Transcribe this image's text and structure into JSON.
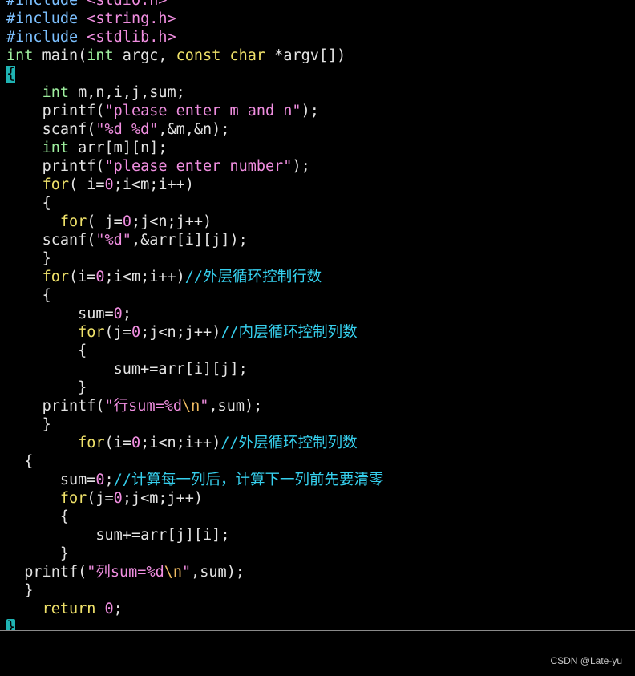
{
  "editor": {
    "lines": [
      {
        "indent": "",
        "tokens": [
          {
            "t": "#include ",
            "c": "pre"
          },
          {
            "t": "<stdio.h>",
            "c": "hdr"
          }
        ]
      },
      {
        "indent": "",
        "tokens": [
          {
            "t": "#include ",
            "c": "pre"
          },
          {
            "t": "<string.h>",
            "c": "hdr"
          }
        ]
      },
      {
        "indent": "",
        "tokens": [
          {
            "t": "#include ",
            "c": "pre"
          },
          {
            "t": "<stdlib.h>",
            "c": "hdr"
          }
        ]
      },
      {
        "indent": "",
        "tokens": [
          {
            "t": "int",
            "c": "type"
          },
          {
            "t": " main(",
            "c": "id"
          },
          {
            "t": "int",
            "c": "type"
          },
          {
            "t": " argc, ",
            "c": "id"
          },
          {
            "t": "const",
            "c": "kw"
          },
          {
            "t": " ",
            "c": "id"
          },
          {
            "t": "char",
            "c": "kw"
          },
          {
            "t": " *argv[])",
            "c": "id"
          }
        ]
      },
      {
        "indent": "",
        "tokens": [
          {
            "t": "{",
            "c": "brace-hl"
          }
        ]
      },
      {
        "indent": "    ",
        "tokens": [
          {
            "t": "int",
            "c": "type"
          },
          {
            "t": " m,n,i,j,sum;",
            "c": "id"
          }
        ]
      },
      {
        "indent": "    ",
        "tokens": [
          {
            "t": "printf(",
            "c": "id"
          },
          {
            "t": "\"please enter m and n\"",
            "c": "str"
          },
          {
            "t": ");",
            "c": "id"
          }
        ]
      },
      {
        "indent": "    ",
        "tokens": [
          {
            "t": "scanf(",
            "c": "id"
          },
          {
            "t": "\"%d %d\"",
            "c": "str"
          },
          {
            "t": ",&m,&n);",
            "c": "id"
          }
        ]
      },
      {
        "indent": "    ",
        "tokens": [
          {
            "t": "int",
            "c": "type"
          },
          {
            "t": " arr[m][n];",
            "c": "id"
          }
        ]
      },
      {
        "indent": "    ",
        "tokens": [
          {
            "t": "printf(",
            "c": "id"
          },
          {
            "t": "\"please enter number\"",
            "c": "str"
          },
          {
            "t": ");",
            "c": "id"
          }
        ]
      },
      {
        "indent": "    ",
        "tokens": [
          {
            "t": "for",
            "c": "kw"
          },
          {
            "t": "( i=",
            "c": "id"
          },
          {
            "t": "0",
            "c": "num"
          },
          {
            "t": ";i<m;i++)",
            "c": "id"
          }
        ]
      },
      {
        "indent": "    ",
        "tokens": [
          {
            "t": "{",
            "c": "id"
          }
        ]
      },
      {
        "indent": "      ",
        "tokens": [
          {
            "t": "for",
            "c": "kw"
          },
          {
            "t": "( j=",
            "c": "id"
          },
          {
            "t": "0",
            "c": "num"
          },
          {
            "t": ";j<n;j++)",
            "c": "id"
          }
        ]
      },
      {
        "indent": "    ",
        "tokens": [
          {
            "t": "scanf(",
            "c": "id"
          },
          {
            "t": "\"%d\"",
            "c": "str"
          },
          {
            "t": ",&arr[i][j]);",
            "c": "id"
          }
        ]
      },
      {
        "indent": "    ",
        "tokens": [
          {
            "t": "}",
            "c": "id"
          }
        ]
      },
      {
        "indent": "    ",
        "tokens": [
          {
            "t": "for",
            "c": "kw"
          },
          {
            "t": "(i=",
            "c": "id"
          },
          {
            "t": "0",
            "c": "num"
          },
          {
            "t": ";i<m;i++)",
            "c": "id"
          },
          {
            "t": "//外层循环控制行数",
            "c": "cmt"
          }
        ]
      },
      {
        "indent": "    ",
        "tokens": [
          {
            "t": "{",
            "c": "id"
          }
        ]
      },
      {
        "indent": "        ",
        "tokens": [
          {
            "t": "sum=",
            "c": "id"
          },
          {
            "t": "0",
            "c": "num"
          },
          {
            "t": ";",
            "c": "id"
          }
        ]
      },
      {
        "indent": "        ",
        "tokens": [
          {
            "t": "for",
            "c": "kw"
          },
          {
            "t": "(j=",
            "c": "id"
          },
          {
            "t": "0",
            "c": "num"
          },
          {
            "t": ";j<n;j++)",
            "c": "id"
          },
          {
            "t": "//内层循环控制列数",
            "c": "cmt"
          }
        ]
      },
      {
        "indent": "        ",
        "tokens": [
          {
            "t": "{",
            "c": "id"
          }
        ]
      },
      {
        "indent": "            ",
        "tokens": [
          {
            "t": "sum+=arr[i][j];",
            "c": "id"
          }
        ]
      },
      {
        "indent": "        ",
        "tokens": [
          {
            "t": "}",
            "c": "id"
          }
        ]
      },
      {
        "indent": "    ",
        "tokens": [
          {
            "t": "printf(",
            "c": "id"
          },
          {
            "t": "\"行sum=%d",
            "c": "str"
          },
          {
            "t": "\\n",
            "c": "esc"
          },
          {
            "t": "\"",
            "c": "str"
          },
          {
            "t": ",sum);",
            "c": "id"
          }
        ]
      },
      {
        "indent": "    ",
        "tokens": [
          {
            "t": "}",
            "c": "id"
          }
        ]
      },
      {
        "indent": "        ",
        "tokens": [
          {
            "t": "for",
            "c": "kw"
          },
          {
            "t": "(i=",
            "c": "id"
          },
          {
            "t": "0",
            "c": "num"
          },
          {
            "t": ";i<n;i++)",
            "c": "id"
          },
          {
            "t": "//外层循环控制列数",
            "c": "cmt"
          }
        ]
      },
      {
        "indent": "  ",
        "tokens": [
          {
            "t": "{",
            "c": "id"
          }
        ]
      },
      {
        "indent": "      ",
        "tokens": [
          {
            "t": "sum=",
            "c": "id"
          },
          {
            "t": "0",
            "c": "num"
          },
          {
            "t": ";",
            "c": "id"
          },
          {
            "t": "//计算每一列后，计算下一列前先要清零",
            "c": "cmt"
          }
        ]
      },
      {
        "indent": "      ",
        "tokens": [
          {
            "t": "for",
            "c": "kw"
          },
          {
            "t": "(j=",
            "c": "id"
          },
          {
            "t": "0",
            "c": "num"
          },
          {
            "t": ";j<m;j++)",
            "c": "id"
          }
        ]
      },
      {
        "indent": "      ",
        "tokens": [
          {
            "t": "{",
            "c": "id"
          }
        ]
      },
      {
        "indent": "          ",
        "tokens": [
          {
            "t": "sum+=arr[j][i];",
            "c": "id"
          }
        ]
      },
      {
        "indent": "      ",
        "tokens": [
          {
            "t": "}",
            "c": "id"
          }
        ]
      },
      {
        "indent": "  ",
        "tokens": [
          {
            "t": "printf(",
            "c": "id"
          },
          {
            "t": "\"列sum=%d",
            "c": "str"
          },
          {
            "t": "\\n",
            "c": "esc"
          },
          {
            "t": "\"",
            "c": "str"
          },
          {
            "t": ",sum);",
            "c": "id"
          }
        ]
      },
      {
        "indent": "  ",
        "tokens": [
          {
            "t": "}",
            "c": "id"
          }
        ]
      },
      {
        "indent": "    ",
        "tokens": [
          {
            "t": "return",
            "c": "kw"
          },
          {
            "t": " ",
            "c": "id"
          },
          {
            "t": "0",
            "c": "num"
          },
          {
            "t": ";",
            "c": "id"
          }
        ]
      },
      {
        "indent": "",
        "tokens": [
          {
            "t": "}",
            "c": "cursor"
          }
        ]
      }
    ]
  },
  "watermark": {
    "text": "CSDN @Late-yu"
  },
  "colors": {
    "background": "#000000",
    "keyword": "#f0e26a",
    "type": "#9ff09f",
    "preprocessor": "#7cc0ff",
    "string": "#f08ee0",
    "comment": "#36d0ee",
    "identifier": "#e4e4e4",
    "cursor": "#1fb3b3"
  }
}
